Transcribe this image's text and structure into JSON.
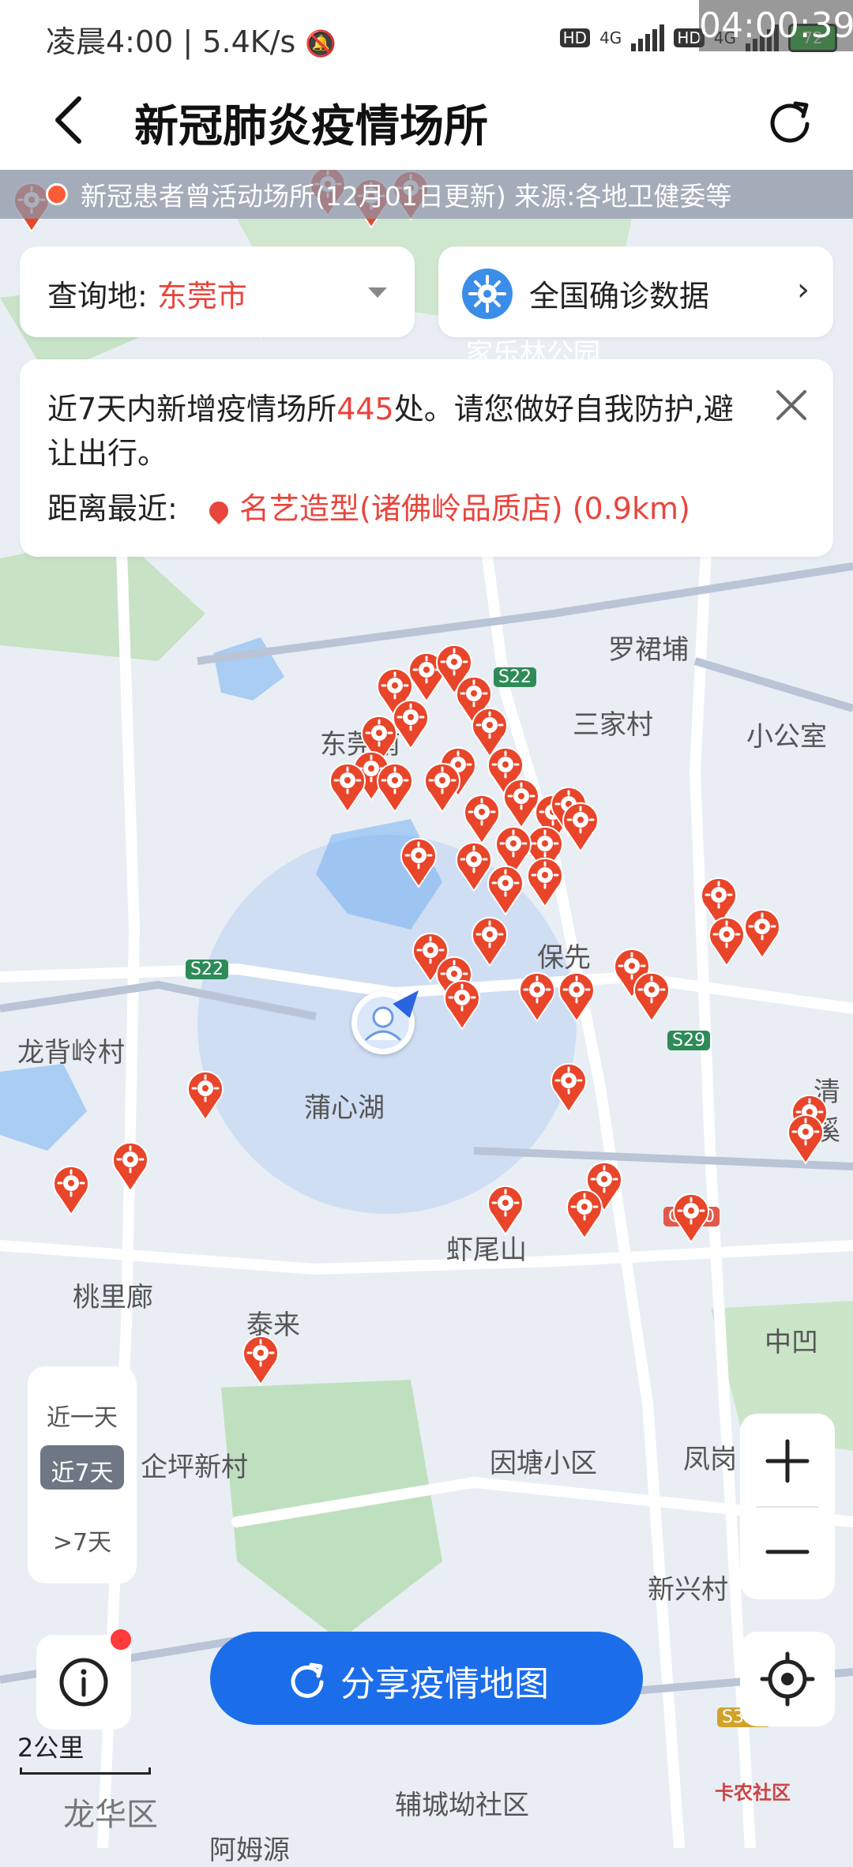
{
  "status_bar": {
    "time": "凌晨4:00",
    "speed": "5.4K/s",
    "network_1": "HD",
    "network_2": "HD",
    "net_type": "4G",
    "battery": "72",
    "overlay_clock": "04:00:39"
  },
  "header": {
    "title": "新冠肺炎疫情场所"
  },
  "banner": {
    "text": "新冠患者曾活动场所(12月01日更新)  来源:各地卫健委等"
  },
  "query": {
    "label": "查询地:",
    "city": "东莞市",
    "national_label": "全国确诊数据"
  },
  "info": {
    "line_prefix": "近7天内新增疫情场所",
    "count": "445",
    "line_suffix": "处。请您做好自我防护,避让出行。",
    "nearest_label": "距离最近:",
    "nearest_value": "名艺造型(诸佛岭品质店) (0.9km)"
  },
  "map_labels": [
    "家乐林公园",
    "罗裙埔",
    "S22",
    "三家村",
    "小公室",
    "东莞南",
    "保先",
    "S22",
    "龙背岭村",
    "蒲心湖",
    "S29",
    "桃里廊",
    "泰来",
    "虾尾山",
    "G220",
    "中凹",
    "企坪新村",
    "因塘小区",
    "凤岗",
    "新兴村",
    "龙华区",
    "辅城坳社区",
    "阿姆源",
    "S359",
    "清溪"
  ],
  "filter": {
    "items": [
      "近一天",
      "近7天",
      ">7天"
    ],
    "active": "近7天"
  },
  "share_button": "分享疫情地图",
  "scale": "2公里",
  "watermark": "卡农社区",
  "colors": {
    "accent_red": "#e8453c",
    "brand_blue": "#1c6dea",
    "marker": "#e8452a"
  }
}
